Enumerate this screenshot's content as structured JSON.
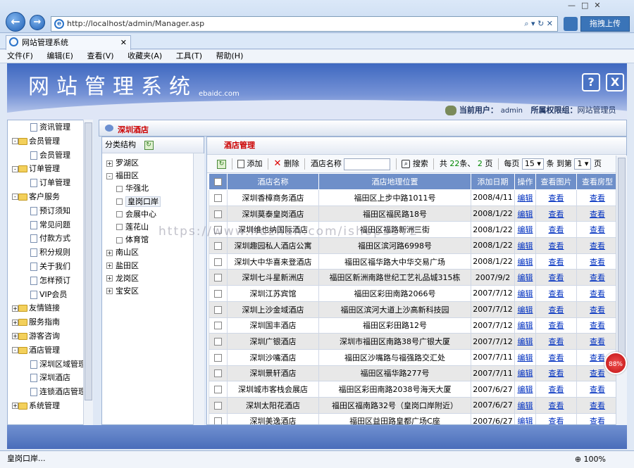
{
  "browser": {
    "url": "http://localhost/admin/Manager.asp",
    "tab_title": "网站管理系统",
    "drag_upload": "拖拽上传",
    "menu": [
      "文件(F)",
      "编辑(E)",
      "查看(V)",
      "收藏夹(A)",
      "工具(T)",
      "帮助(H)"
    ],
    "status_text": "皇岗口岸...",
    "zoom": "100%",
    "badge": "88%"
  },
  "banner": {
    "title": "网站管理系统",
    "subtitle": "ebaidc.com",
    "help_label": "?",
    "exit_label": "X",
    "current_user_label": "当前用户：",
    "current_user": "admin",
    "group_label": "所属权限组：",
    "group": "网站管理员"
  },
  "sidebar": {
    "items": [
      {
        "type": "doc",
        "label": "资讯管理",
        "indent": 2
      },
      {
        "type": "folder",
        "label": "会员管理",
        "indent": 1,
        "state": "-"
      },
      {
        "type": "doc",
        "label": "会员管理",
        "indent": 2
      },
      {
        "type": "folder",
        "label": "订单管理",
        "indent": 1,
        "state": "-"
      },
      {
        "type": "doc",
        "label": "订单管理",
        "indent": 2
      },
      {
        "type": "folder",
        "label": "客户服务",
        "indent": 1,
        "state": "-"
      },
      {
        "type": "doc",
        "label": "预订须知",
        "indent": 2
      },
      {
        "type": "doc",
        "label": "常见问题",
        "indent": 2
      },
      {
        "type": "doc",
        "label": "付款方式",
        "indent": 2
      },
      {
        "type": "doc",
        "label": "积分规则",
        "indent": 2
      },
      {
        "type": "doc",
        "label": "关于我们",
        "indent": 2
      },
      {
        "type": "doc",
        "label": "怎样预订",
        "indent": 2
      },
      {
        "type": "doc",
        "label": "VIP会员",
        "indent": 2
      },
      {
        "type": "folder",
        "label": "友情链接",
        "indent": 1,
        "state": "+"
      },
      {
        "type": "folder",
        "label": "服务指南",
        "indent": 1,
        "state": "+"
      },
      {
        "type": "folder",
        "label": "游客咨询",
        "indent": 1,
        "state": "+"
      },
      {
        "type": "folder",
        "label": "酒店管理",
        "indent": 1,
        "state": "-"
      },
      {
        "type": "doc",
        "label": "深圳区域管理",
        "indent": 2
      },
      {
        "type": "doc",
        "label": "深圳酒店",
        "indent": 2
      },
      {
        "type": "doc",
        "label": "连锁酒店管理",
        "indent": 2
      },
      {
        "type": "folder",
        "label": "系统管理",
        "indent": 1,
        "state": "+"
      }
    ]
  },
  "middle": {
    "title": "深圳酒店",
    "category_header": "分类结构",
    "categories": [
      {
        "label": "罗湖区",
        "level": 0,
        "state": "+"
      },
      {
        "label": "福田区",
        "level": 0,
        "state": "-"
      },
      {
        "label": "华强北",
        "level": 1
      },
      {
        "label": "皇岗口岸",
        "level": 1,
        "selected": true
      },
      {
        "label": "会展中心",
        "level": 1
      },
      {
        "label": "莲花山",
        "level": 1
      },
      {
        "label": "体育馆",
        "level": 1
      },
      {
        "label": "南山区",
        "level": 0,
        "state": "+"
      },
      {
        "label": "盐田区",
        "level": 0,
        "state": "+"
      },
      {
        "label": "龙岗区",
        "level": 0,
        "state": "+"
      },
      {
        "label": "宝安区",
        "level": 0,
        "state": "+"
      }
    ]
  },
  "main": {
    "title": "酒店管理",
    "toolbar": {
      "add": "添加",
      "delete": "删除",
      "search_label": "酒店名称",
      "search_button": "搜索",
      "total_prefix": "共",
      "total": "22",
      "total_unit": "条、",
      "pages": "2",
      "pages_unit": "页",
      "per_page_label": "每页",
      "per_page": "15",
      "per_page_unit": "条",
      "goto_label": "到第",
      "goto_page": "1",
      "goto_unit": "页"
    },
    "columns": [
      "",
      "酒店名称",
      "酒店地理位置",
      "添加日期",
      "操作",
      "查看图片",
      "查看房型"
    ],
    "edit_label": "编辑",
    "view_label": "查看",
    "rows": [
      [
        "深圳香樟商务酒店",
        "福田区上步中路1011号",
        "2008/4/11"
      ],
      [
        "深圳莫泰皇岗酒店",
        "福田区福民路18号",
        "2008/1/22"
      ],
      [
        "深圳维也纳国际酒店",
        "福田区福路新洲三街",
        "2008/1/22"
      ],
      [
        "深圳趣园私人酒店公寓",
        "福田区滨河路6998号",
        "2008/1/22"
      ],
      [
        "深圳大中华喜来登酒店",
        "福田区福华路大中华交易广场",
        "2008/1/22"
      ],
      [
        "深圳七斗星新洲店",
        "福田区新洲南路世纪工艺礼品城315栋",
        "2007/9/2"
      ],
      [
        "深圳江苏宾馆",
        "福田区彩田南路2066号",
        "2007/7/12"
      ],
      [
        "深圳上沙金域酒店",
        "福田区滨河大道上沙高新科技园",
        "2007/7/12"
      ],
      [
        "深圳国丰酒店",
        "福田区彩田路12号",
        "2007/7/12"
      ],
      [
        "深圳广银酒店",
        "深圳市福田区南路38号广银大厦",
        "2007/7/12"
      ],
      [
        "深圳沙嘴酒店",
        "福田区沙嘴路与福强路交汇处",
        "2007/7/11"
      ],
      [
        "深圳景轩酒店",
        "福田区福华路277号",
        "2007/7/11"
      ],
      [
        "深圳城市客栈会展店",
        "福田区彩田南路2038号海天大厦",
        "2007/6/27"
      ],
      [
        "深圳太阳花酒店",
        "福田区福南路32号（皇岗口岸附近）",
        "2007/6/27"
      ],
      [
        "深圳美逸酒店",
        "福田区益田路皇都广场C座",
        "2007/6/27"
      ]
    ]
  },
  "watermark": "https://www.huzhan.com/ishop3572"
}
